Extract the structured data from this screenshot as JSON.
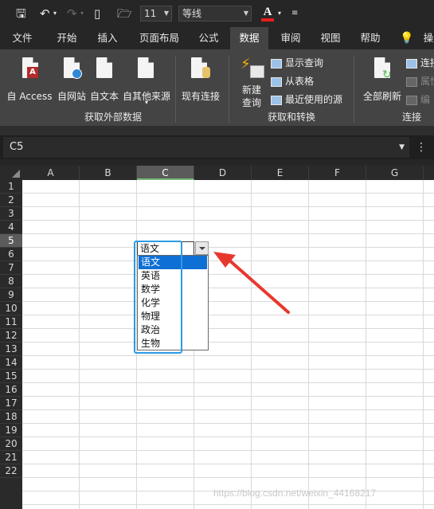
{
  "toolbar": {
    "font_size": "11",
    "font_name": "等线",
    "font_color_letter": "A",
    "font_color": "#e81d1d"
  },
  "tabs": [
    {
      "label": "文件"
    },
    {
      "label": "开始"
    },
    {
      "label": "插入"
    },
    {
      "label": "页面布局"
    },
    {
      "label": "公式"
    },
    {
      "label": "数据"
    },
    {
      "label": "审阅"
    },
    {
      "label": "视图"
    },
    {
      "label": "帮助"
    },
    {
      "label": "操"
    }
  ],
  "active_tab": "数据",
  "ribbon": {
    "external_group": {
      "label": "获取外部数据",
      "buttons": [
        "自 Access",
        "自网站",
        "自文本",
        "自其他来源",
        "现有连接"
      ]
    },
    "transform_group": {
      "label": "获取和转换",
      "new_query_line1": "新建",
      "new_query_line2": "查询",
      "show_queries": "显示查询",
      "from_table": "从表格",
      "recent_sources": "最近使用的源"
    },
    "connections_group": {
      "label": "连接",
      "refresh_all": "全部刷新",
      "connections": "连接",
      "properties": "属性",
      "edit_links": "编"
    }
  },
  "formula_bar": {
    "name_box": "C5"
  },
  "columns": [
    "A",
    "B",
    "C",
    "D",
    "E",
    "F",
    "G"
  ],
  "selected_column": "C",
  "rows": [
    "1",
    "2",
    "3",
    "4",
    "5",
    "6",
    "7",
    "8",
    "9",
    "10",
    "11",
    "12",
    "13",
    "14",
    "15",
    "16",
    "17",
    "18",
    "19",
    "20",
    "21",
    "22"
  ],
  "selected_row": "5",
  "cell": {
    "address": "C5",
    "value": "语文"
  },
  "dropdown": {
    "options": [
      "语文",
      "英语",
      "数学",
      "化学",
      "物理",
      "政治",
      "生物"
    ],
    "selected": "语文"
  },
  "annotation": {
    "box_color": "#2b9be6",
    "arrow_color": "#e8382e"
  },
  "watermark": "https://blog.csdn.net/weixin_44168217"
}
